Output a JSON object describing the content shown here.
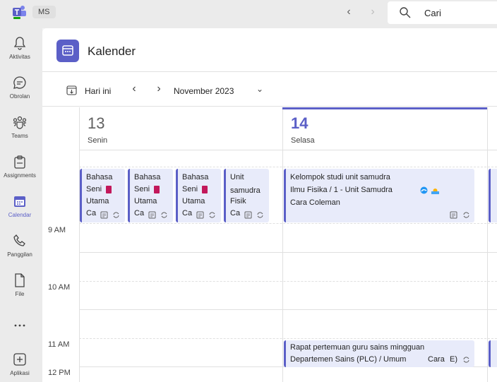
{
  "topbar": {
    "account": "MS",
    "search_placeholder": "Cari"
  },
  "rail": {
    "items": [
      {
        "label": "Aktivitas",
        "icon": "bell-icon"
      },
      {
        "label": "Obrolan",
        "icon": "chat-icon"
      },
      {
        "label": "Teams",
        "icon": "teams-icon"
      },
      {
        "label": "Assignments",
        "icon": "assignments-icon"
      },
      {
        "label": "Calendar",
        "icon": "calendar-icon",
        "active": true
      },
      {
        "label": "Panggilan",
        "icon": "phone-icon"
      },
      {
        "label": "File",
        "icon": "file-icon"
      },
      {
        "label": "",
        "icon": "more-icon"
      },
      {
        "label": "Aplikasi",
        "icon": "add-apps-icon"
      }
    ]
  },
  "header": {
    "title": "Kalender"
  },
  "toolbar": {
    "today_label": "Hari ini",
    "month_label": "November 2023"
  },
  "days": [
    {
      "num": "13",
      "name": "Senin"
    },
    {
      "num": "14",
      "name": "Selasa"
    }
  ],
  "times": [
    "9 AM",
    "10 AM",
    "11 AM",
    "12 PM"
  ],
  "events_mon": [
    {
      "l1": "Bahasa",
      "l2": "Seni",
      "l3": "Utama",
      "l4": "Ca"
    },
    {
      "l1": "Bahasa",
      "l2": "Seni",
      "l3": "Utama",
      "l4": "Ca"
    },
    {
      "l1": "Bahasa",
      "l2": "Seni",
      "l3": "Utama",
      "l4": "Ca"
    },
    {
      "l1": "Unit",
      "l2": "samudra",
      "l3": "Fisik",
      "l4": "Ca"
    }
  ],
  "event_tue_1": {
    "title": "Kelompok studi unit samudra",
    "line2": "Ilmu Fisika / 1 - Unit Samudra",
    "line3": "Cara Coleman"
  },
  "event_tue_2": {
    "title": "Rapat pertemuan guru sains mingguan",
    "line2": "Departemen Sains (PLC) / Umum",
    "organizer": "Cara",
    "extra": "E)"
  },
  "colors": {
    "accent": "#5b5fc7",
    "event_bg": "#e8ebfa"
  }
}
